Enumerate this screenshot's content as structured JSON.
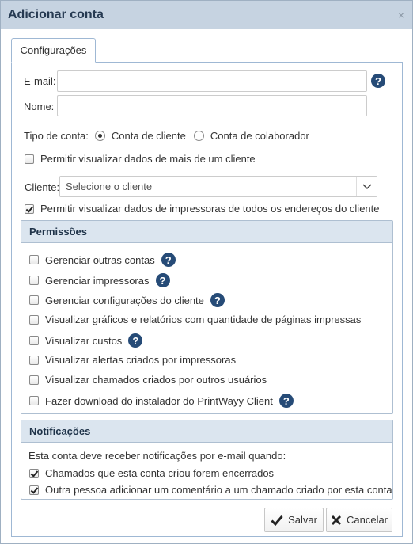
{
  "dialog": {
    "title": "Adicionar conta",
    "close_glyph": "×"
  },
  "tabs": [
    {
      "label": "Configurações",
      "active": true
    }
  ],
  "form": {
    "email_label": "E-mail:",
    "email_value": "",
    "nome_label": "Nome:",
    "nome_value": "",
    "help_glyph": "?",
    "tipo_label": "Tipo de conta:",
    "tipo_options": [
      {
        "label": "Conta de cliente",
        "checked": true
      },
      {
        "label": "Conta de colaborador",
        "checked": false
      }
    ],
    "multi_cliente_label": "Permitir visualizar dados de mais de um cliente",
    "multi_cliente_checked": false,
    "cliente_label": "Cliente:",
    "cliente_placeholder": "Selecione o cliente",
    "enderecos_label": "Permitir visualizar dados de impressoras de todos os endereços do cliente",
    "enderecos_checked": true
  },
  "permissoes": {
    "title": "Permissões",
    "items": [
      {
        "label": "Gerenciar outras contas",
        "checked": false,
        "help": true
      },
      {
        "label": "Gerenciar impressoras",
        "checked": false,
        "help": true
      },
      {
        "label": "Gerenciar configurações do cliente",
        "checked": false,
        "help": true
      },
      {
        "label": "Visualizar gráficos e relatórios com quantidade de páginas impressas",
        "checked": false,
        "help": false
      },
      {
        "label": "Visualizar custos",
        "checked": false,
        "help": true
      },
      {
        "label": "Visualizar alertas criados por impressoras",
        "checked": false,
        "help": false
      },
      {
        "label": "Visualizar chamados criados por outros usuários",
        "checked": false,
        "help": false
      },
      {
        "label": "Fazer download do instalador do PrintWayy Client",
        "checked": false,
        "help": true
      }
    ]
  },
  "notificacoes": {
    "title": "Notificações",
    "intro": "Esta conta deve receber notificações por e-mail quando:",
    "items": [
      {
        "label": "Chamados que esta conta criou forem encerrados",
        "checked": true
      },
      {
        "label": "Outra pessoa adicionar um comentário a um chamado criado por esta conta",
        "checked": true
      }
    ]
  },
  "buttons": {
    "save_label": "Salvar",
    "save_icon": "check-icon",
    "cancel_label": "Cancelar",
    "cancel_icon": "x-icon"
  },
  "colors": {
    "titlebar": "#c6d3e1",
    "panel_header": "#dbe5ef",
    "help_badge": "#264b77"
  }
}
